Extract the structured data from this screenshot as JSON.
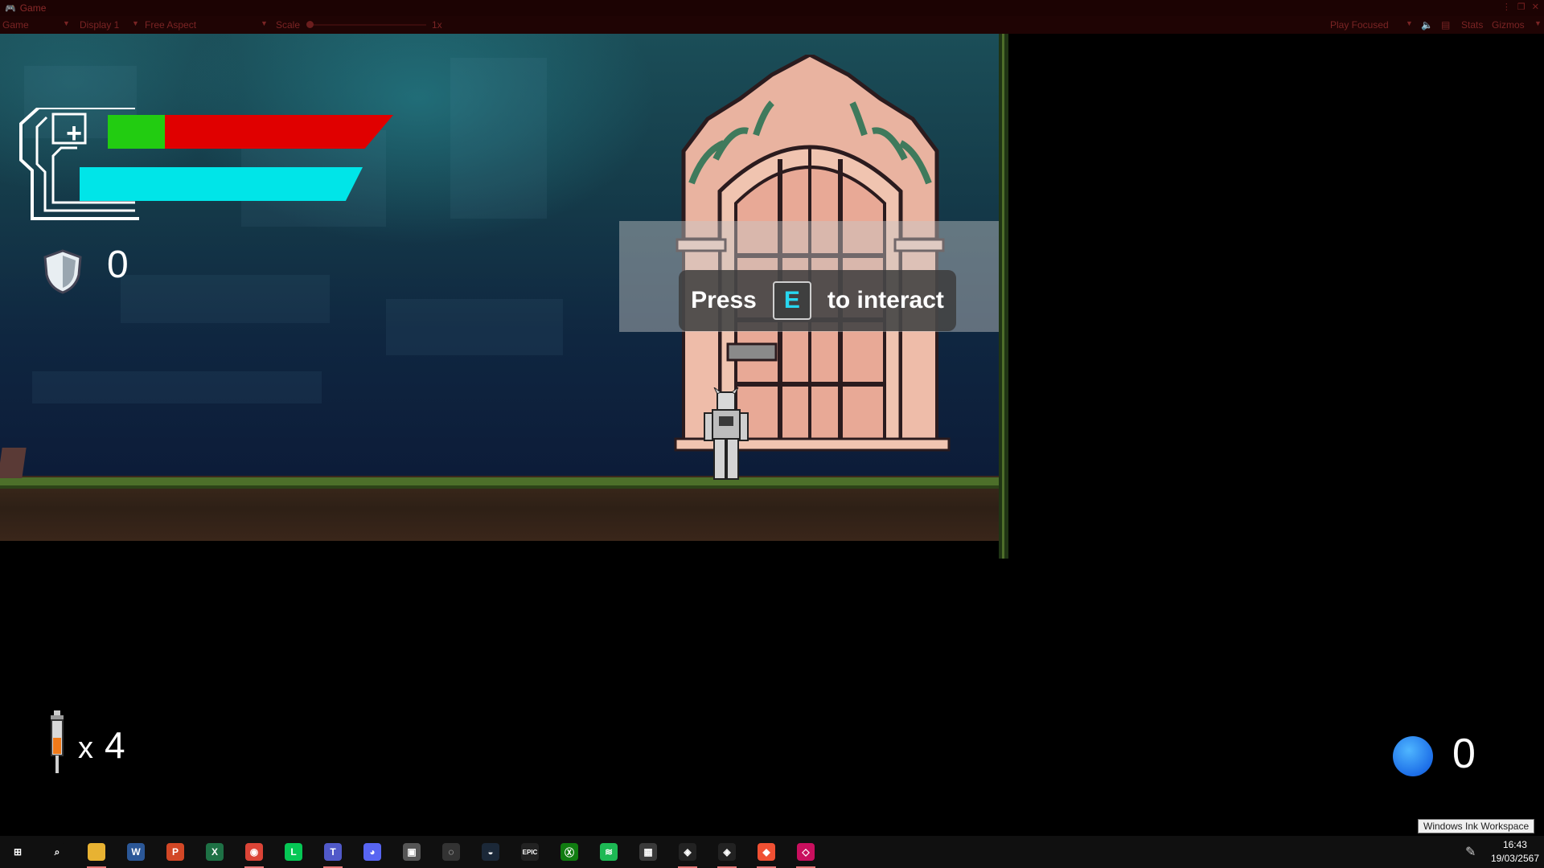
{
  "editor": {
    "tab_title": "Game",
    "toolbar": {
      "view_mode": "Game",
      "display": "Display 1",
      "aspect": "Free Aspect",
      "scale_label": "Scale",
      "scale_value": "1x",
      "play_mode": "Play Focused",
      "stats": "Stats",
      "gizmos": "Gizmos"
    },
    "window_controls": [
      "⋮",
      "❐",
      "✕"
    ]
  },
  "hud": {
    "health_fraction": 0.2,
    "energy_fraction": 1.0,
    "shield_count": "0",
    "syringe_prefix": "x",
    "syringe_count": "4",
    "orb_count": "0"
  },
  "prompt": {
    "before": "Press",
    "key": "E",
    "after": "to interact"
  },
  "tooltip": "Windows Ink Workspace",
  "taskbar": {
    "apps": [
      {
        "name": "start-icon",
        "glyph": "⊞",
        "color": "#101010"
      },
      {
        "name": "search-icon",
        "glyph": "⌕",
        "color": "#101010"
      },
      {
        "name": "file-explorer-icon",
        "glyph": "",
        "color": "#e8b232"
      },
      {
        "name": "word-icon",
        "glyph": "W",
        "color": "#2b5797"
      },
      {
        "name": "powerpoint-icon",
        "glyph": "P",
        "color": "#d24726"
      },
      {
        "name": "excel-icon",
        "glyph": "X",
        "color": "#1e7145"
      },
      {
        "name": "chrome-icon",
        "glyph": "◉",
        "color": "#db4437"
      },
      {
        "name": "line-icon",
        "glyph": "L",
        "color": "#06c755"
      },
      {
        "name": "teams-icon",
        "glyph": "T",
        "color": "#5059c9"
      },
      {
        "name": "discord-icon",
        "glyph": "◕",
        "color": "#5865f2"
      },
      {
        "name": "photos-icon",
        "glyph": "▣",
        "color": "#555"
      },
      {
        "name": "obs-icon",
        "glyph": "◌",
        "color": "#333"
      },
      {
        "name": "steam-icon",
        "glyph": "◒",
        "color": "#1b2838"
      },
      {
        "name": "epic-games-icon",
        "glyph": "EPIC",
        "color": "#222"
      },
      {
        "name": "xbox-icon",
        "glyph": "Ⓧ",
        "color": "#107c10"
      },
      {
        "name": "spotify-icon",
        "glyph": "≋",
        "color": "#1db954"
      },
      {
        "name": "calculator-icon",
        "glyph": "▦",
        "color": "#3a3a3a"
      },
      {
        "name": "unity-hub-icon",
        "glyph": "◈",
        "color": "#222"
      },
      {
        "name": "unity-icon",
        "glyph": "◈",
        "color": "#222"
      },
      {
        "name": "git-icon",
        "glyph": "◆",
        "color": "#f05033"
      },
      {
        "name": "rider-icon",
        "glyph": "◇",
        "color": "#c90f5e"
      }
    ],
    "time": "16:43",
    "date": "19/03/2567"
  }
}
